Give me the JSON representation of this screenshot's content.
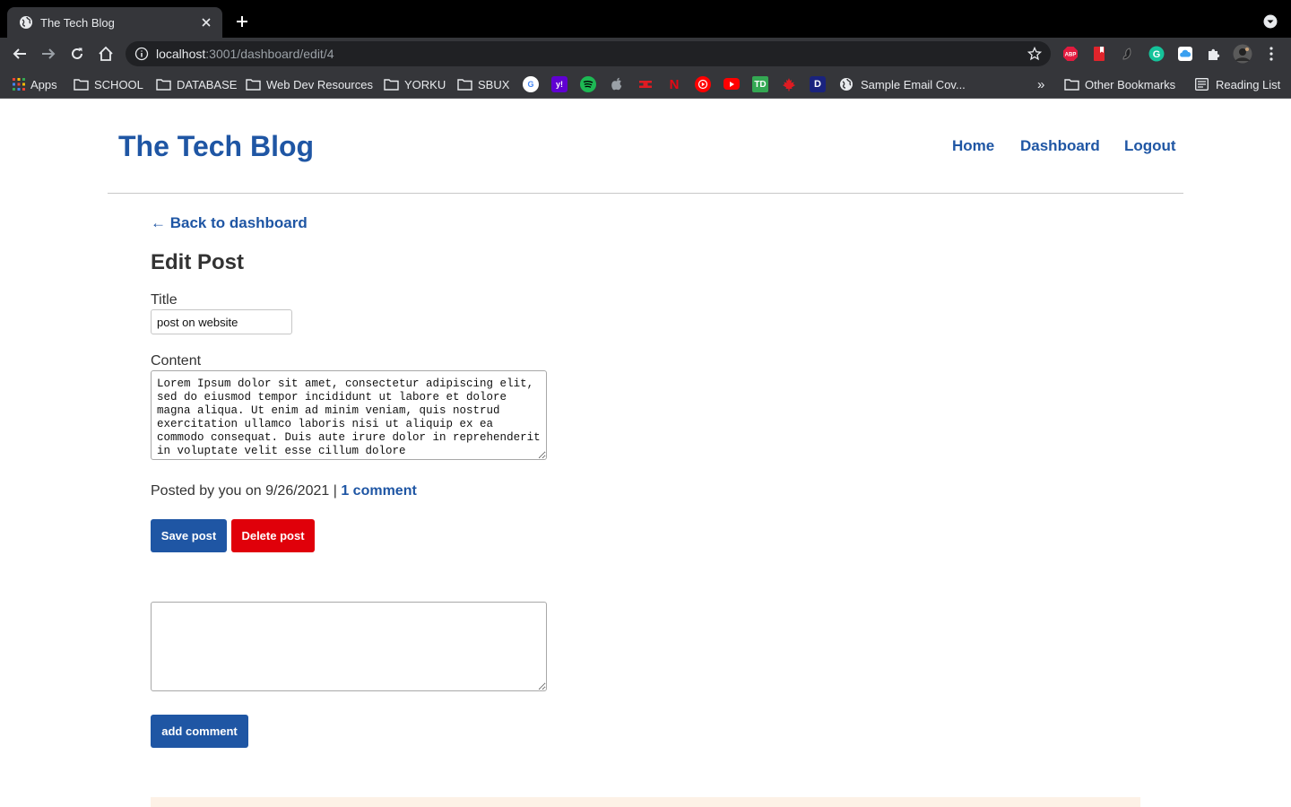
{
  "browser": {
    "tab": {
      "title": "The Tech Blog"
    },
    "address": {
      "host": "localhost",
      "path": ":3001/dashboard/edit/4"
    },
    "bookmarks": {
      "apps": "Apps",
      "folders": [
        "SCHOOL",
        "DATABASE",
        "Web Dev Resources",
        "YORKU",
        "SBUX"
      ],
      "sample_email": "Sample Email Cov...",
      "overflow": "»",
      "other": "Other Bookmarks",
      "reading_list": "Reading List"
    },
    "extensions": [
      "ABP",
      "",
      "",
      "",
      "",
      "",
      ""
    ]
  },
  "site": {
    "title": "The Tech Blog",
    "nav": [
      "Home",
      "Dashboard",
      "Logout"
    ]
  },
  "editor": {
    "back_link": "← Back to dashboard",
    "heading": "Edit Post",
    "title_label": "Title",
    "title_value": "post on website",
    "content_label": "Content",
    "content_value": "Lorem Ipsum dolor sit amet, consectetur adipiscing elit, sed do eiusmod tempor incididunt ut labore et dolore magna aliqua. Ut enim ad minim veniam, quis nostrud exercitation ullamco laboris nisi ut aliquip ex ea commodo consequat. Duis aute irure dolor in reprehenderit in voluptate velit esse cillum dolore",
    "meta_prefix": "Posted by you on 9/26/2021",
    "meta_separator": "|",
    "comments_link": "1 comment",
    "save_label": "Save post",
    "delete_label": "Delete post"
  },
  "comment": {
    "value": "",
    "submit_label": "add comment"
  },
  "colors": {
    "brand_blue": "#1f56a4",
    "danger_red": "#e0000a",
    "footer_tint": "#fdf1e6"
  }
}
